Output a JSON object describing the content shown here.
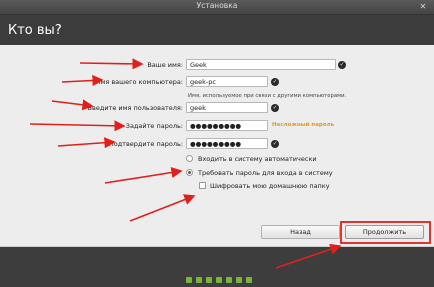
{
  "window": {
    "title": "Установка",
    "close_glyph": "✕"
  },
  "header": {
    "title": "Кто вы?"
  },
  "form": {
    "name": {
      "label": "Ваше имя:",
      "value": "Geek"
    },
    "computer": {
      "label": "Имя вашего компьютера:",
      "value": "geek-pc",
      "hint": "Имя, используемое при связи с другими компьютерами."
    },
    "username": {
      "label": "Введите имя пользователя:",
      "value": "geek"
    },
    "password": {
      "label": "Задайте пароль:",
      "value": "●●●●●●●●●",
      "strength": "Несложный пароль"
    },
    "confirm": {
      "label": "Подтвердите пароль:",
      "value": "●●●●●●●●●"
    },
    "check_glyph": "✓"
  },
  "options": {
    "auto_login": "Входить в систему автоматически",
    "require_password": "Требовать пароль для входа в систему",
    "encrypt_home": "Шифровать мою домашнюю папку"
  },
  "buttons": {
    "back": "Назад",
    "continue": "Продолжить"
  },
  "progress": {
    "steps": 7,
    "current": 6
  },
  "annotation_color": "#e2201b"
}
